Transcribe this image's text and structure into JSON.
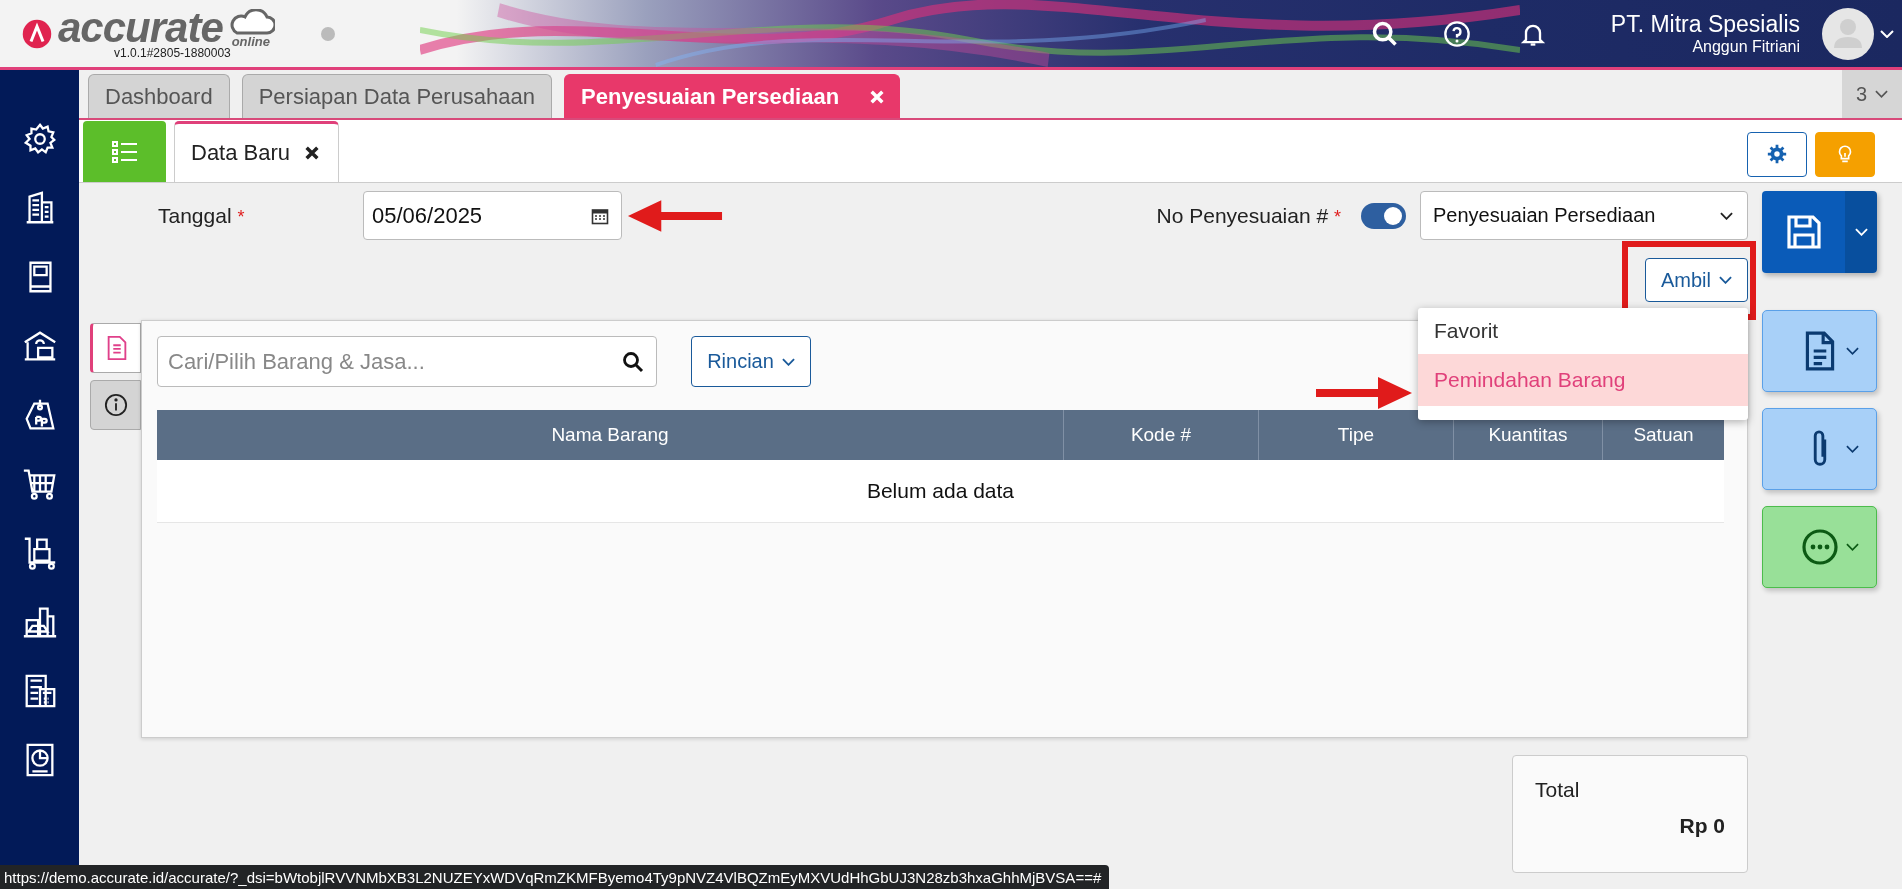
{
  "app": {
    "logo_text": "accurate",
    "logo_sub": "online",
    "version": "v1.0.1#2805-1880003"
  },
  "header": {
    "company": "PT. Mitra Spesialis",
    "user": "Anggun Fitriani"
  },
  "tabs": [
    {
      "label": "Dashboard",
      "selected": false,
      "closable": false
    },
    {
      "label": "Persiapan Data Perusahaan",
      "selected": false,
      "closable": false
    },
    {
      "label": "Penyesuaian Persediaan",
      "selected": true,
      "closable": true
    }
  ],
  "tab_count": "3",
  "sub_tabs": [
    {
      "label": "Data Baru",
      "selected": true,
      "closable": true
    }
  ],
  "form": {
    "date": {
      "label": "Tanggal",
      "required_mark": "*",
      "value": "05/06/2025"
    },
    "number": {
      "label": "No Penyesuaian #",
      "required_mark": "*",
      "auto_number_on": true,
      "value": "Penyesuaian Persediaan"
    },
    "fetch_button": "Ambil"
  },
  "fetch_menu": {
    "open": true,
    "items": [
      {
        "label": "Favorit",
        "selected": false
      },
      {
        "label": "Pemindahan Barang",
        "selected": true
      }
    ]
  },
  "detail": {
    "side_tabs": [
      {
        "kind": "document",
        "selected": true
      },
      {
        "kind": "info",
        "selected": false
      }
    ],
    "search": {
      "placeholder": "Cari/Pilih Barang & Jasa..."
    },
    "detail_button": "Rincian",
    "table": {
      "columns": [
        "Nama Barang",
        "Kode #",
        "Tipe",
        "Kuantitas",
        "Satuan"
      ],
      "empty_text": "Belum ada data"
    }
  },
  "total": {
    "label": "Total",
    "value": "Rp 0"
  },
  "status_url": "https://demo.accurate.id/accurate/?_dsi=bWtobjlRVVNMbXB3L2NUZEYxWDVqRmZKMFByemo4Ty9pNVZ4VlBQZmEyMXVUdHhGbUJ3N28zb3hxaGhhMjBVSA==#"
}
